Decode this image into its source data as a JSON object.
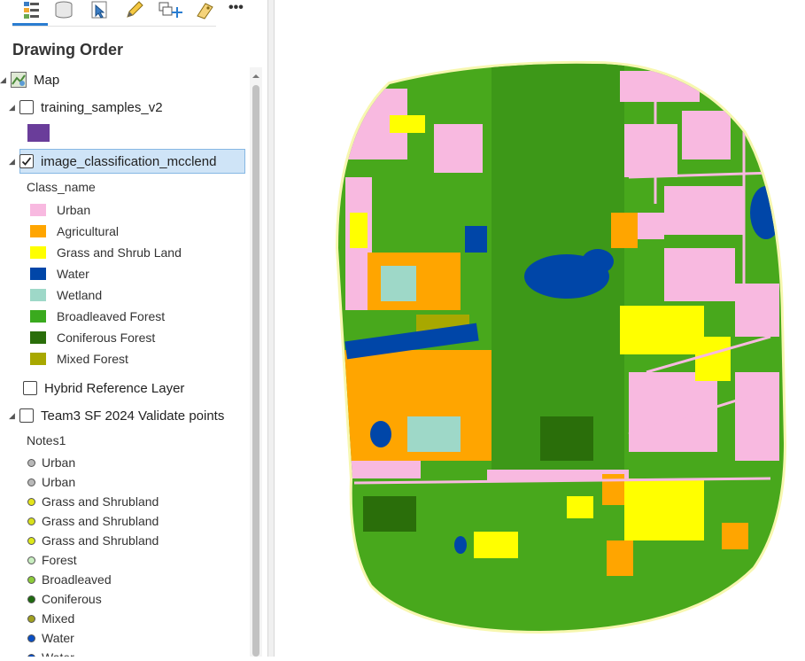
{
  "panel": {
    "title": "Drawing Order",
    "map_label": "Map",
    "layers": {
      "training": {
        "name": "training_samples_v2",
        "swatch_color": "#6a3d9a",
        "checked": false
      },
      "classification": {
        "name": "image_classification_mcclend",
        "checked": true,
        "field": "Class_name",
        "classes": [
          {
            "label": "Urban",
            "color": "#f8b9e0"
          },
          {
            "label": "Agricultural",
            "color": "#ffa500"
          },
          {
            "label": "Grass and Shrub Land",
            "color": "#ffff00"
          },
          {
            "label": "Water",
            "color": "#0046a8"
          },
          {
            "label": "Wetland",
            "color": "#9ed8c8"
          },
          {
            "label": "Broadleaved Forest",
            "color": "#3aaa1e"
          },
          {
            "label": "Coniferous Forest",
            "color": "#2a6e0a"
          },
          {
            "label": "Mixed Forest",
            "color": "#a8a800"
          }
        ]
      },
      "hybrid": {
        "name": "Hybrid Reference Layer",
        "checked": false
      },
      "validate": {
        "name": "Team3 SF 2024 Validate points",
        "checked": false,
        "field": "Notes1",
        "points": [
          {
            "label": "Urban",
            "color": "#b8b8b8"
          },
          {
            "label": "Urban",
            "color": "#b8b8b8"
          },
          {
            "label": "Grass and Shrubland",
            "color": "#e4e41a"
          },
          {
            "label": "Grass and Shrubland",
            "color": "#d8e01c"
          },
          {
            "label": "Grass and Shrubland",
            "color": "#dde81a"
          },
          {
            "label": "Forest",
            "color": "#c8eec0"
          },
          {
            "label": "Broadleaved",
            "color": "#8ccc3a"
          },
          {
            "label": "Coniferous",
            "color": "#1f6a10"
          },
          {
            "label": "Mixed",
            "color": "#a0a020"
          },
          {
            "label": "Water",
            "color": "#0a4fc4"
          },
          {
            "label": "Water",
            "color": "#0a4fc4"
          }
        ]
      }
    }
  },
  "toolbar": {
    "icons": [
      "list-by-drawing-order-icon",
      "list-by-source-icon",
      "list-by-selection-icon",
      "list-by-editing-icon",
      "add-layer-icon",
      "labeling-icon",
      "more-icon"
    ],
    "more_label": "•••"
  }
}
